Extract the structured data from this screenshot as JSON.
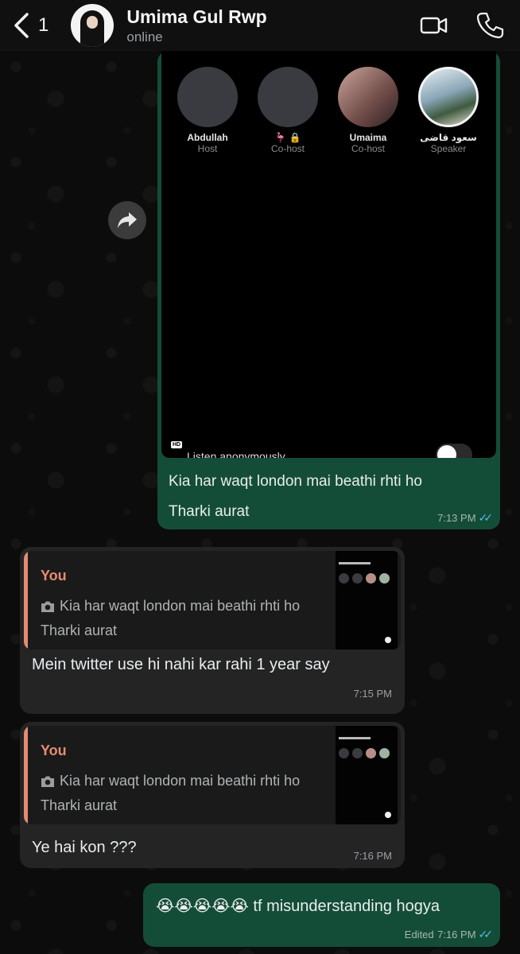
{
  "header": {
    "back_count": "1",
    "contact_name": "Umima Gul Rwp",
    "status": "online",
    "icons": [
      "chevron-left-icon",
      "video-call-icon",
      "phone-icon"
    ]
  },
  "image_message": {
    "speakers": [
      {
        "name": "Abdullah",
        "role": "Host"
      },
      {
        "name": "🦩 🔒",
        "role": "Co-host"
      },
      {
        "name": "Umaima",
        "role": "Co-host"
      },
      {
        "name": "سعود قاضی",
        "role": "Speaker"
      }
    ],
    "hd_badge": "HD",
    "listen_label": "Listen anonymously",
    "caption_line1": "Kia har waqt london mai beathi rhti ho",
    "caption_line2": "Tharki aurat",
    "time": "7:13 PM"
  },
  "messages": [
    {
      "quote_author": "You",
      "quote_line1": "Kia har waqt london mai beathi rhti ho",
      "quote_line2": "Tharki aurat",
      "text": "Mein twitter use hi nahi kar rahi 1 year say",
      "time": "7:15 PM"
    },
    {
      "quote_author": "You",
      "quote_line1": "Kia har waqt london mai beathi rhti ho",
      "quote_line2": "Tharki aurat",
      "text": "Ye hai kon ???",
      "time": "7:16 PM"
    }
  ],
  "last_message": {
    "text": "😭😭😭😭😭 tf misunderstanding hogya",
    "edited_label": "Edited",
    "time": "7:16 PM"
  },
  "colors": {
    "outgoing_bubble": "#144d37",
    "incoming_bubble": "#242424",
    "quote_accent": "#e58c71",
    "read_ticks": "#53bdeb"
  }
}
